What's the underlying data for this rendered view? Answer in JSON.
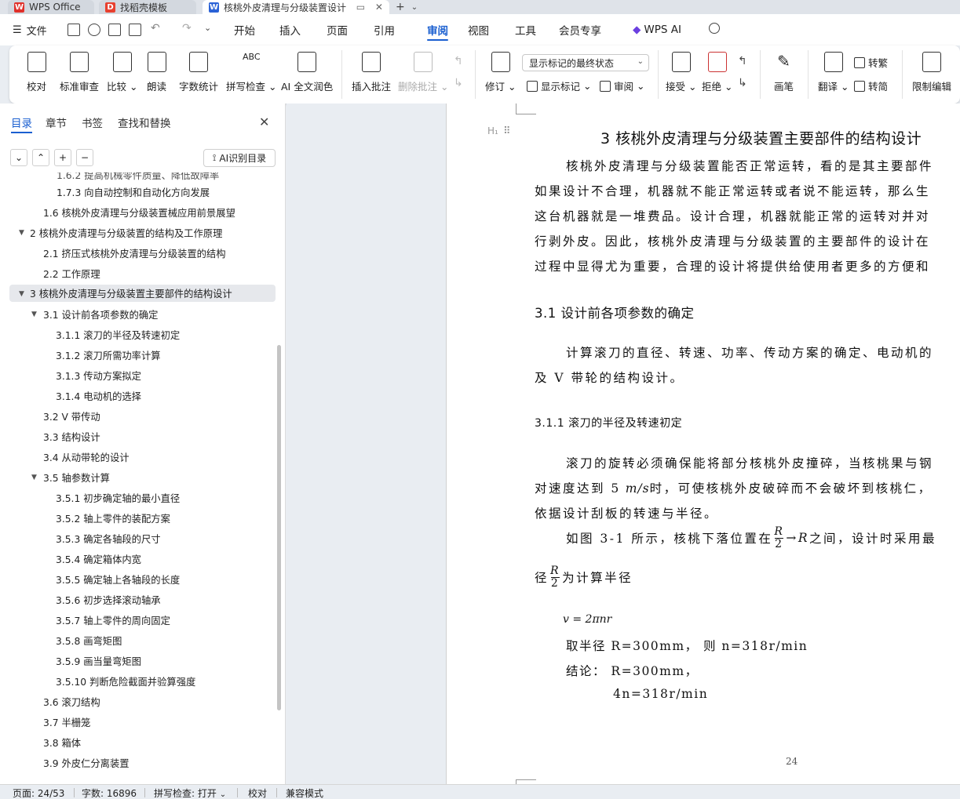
{
  "tabs": [
    {
      "label": "WPS Office",
      "icon": "wps-logo-icon"
    },
    {
      "label": "找稻壳模板",
      "icon": "docer-logo-icon"
    },
    {
      "label": "核桃外皮清理与分级装置设计",
      "icon": "word-doc-icon"
    }
  ],
  "menu": {
    "file": "文件",
    "items": [
      "开始",
      "插入",
      "页面",
      "引用",
      "审阅",
      "视图",
      "工具",
      "会员专享"
    ],
    "active": "审阅",
    "wps_ai": "WPS AI"
  },
  "ribbon": {
    "proofread": "校对",
    "standard_review": "标准审查",
    "compare": "比较",
    "read_aloud": "朗读",
    "word_count": "字数统计",
    "spell_check": "拼写检查",
    "ai_polish": "AI 全文润色",
    "insert_comment": "插入批注",
    "delete_comment": "删除批注",
    "markup_select": "显示标记的最终状态",
    "revise": "修订",
    "show_markup": "显示标记",
    "review": "审阅",
    "accept": "接受",
    "reject": "拒绝",
    "pen": "画笔",
    "translate": "翻译",
    "to_traditional": "转繁",
    "to_simplified": "转简",
    "restrict_edit": "限制编辑"
  },
  "panel": {
    "tabs": [
      "目录",
      "章节",
      "书签",
      "查找和替换"
    ],
    "active_tab": "目录",
    "ai_toc": "AI识别目录",
    "toc": [
      {
        "label": "1.6.2  提高机械零件质量、降低故障率",
        "level": 3
      },
      {
        "label": "1.7.3  向自动控制和自动化方向发展",
        "level": 3
      },
      {
        "label": "1.6  核桃外皮清理与分级装置械应用前景展望",
        "level": 2
      },
      {
        "label": "2   核桃外皮清理与分级装置的结构及工作原理",
        "level": 1,
        "expanded": true
      },
      {
        "label": "2.1  挤压式核桃外皮清理与分级装置的结构",
        "level": 2
      },
      {
        "label": "2.2  工作原理",
        "level": 2
      },
      {
        "label": "3   核桃外皮清理与分级装置主要部件的结构设计",
        "level": 1,
        "expanded": true,
        "selected": true
      },
      {
        "label": "3.1 设计前各项参数的确定",
        "level": 2,
        "expanded": true
      },
      {
        "label": "3.1.1  滚刀的半径及转速初定",
        "level": 3
      },
      {
        "label": "3.1.2  滚刀所需功率计算",
        "level": 3
      },
      {
        "label": "3.1.3  传动方案拟定",
        "level": 3
      },
      {
        "label": "3.1.4  电动机的选择",
        "level": 3
      },
      {
        "label": "3.2 V 带传动",
        "level": 2
      },
      {
        "label": "3.3  结构设计",
        "level": 2
      },
      {
        "label": "3.4  从动带轮的设计",
        "level": 2
      },
      {
        "label": "3.5  轴参数计算",
        "level": 2,
        "expanded": true
      },
      {
        "label": "3.5.1  初步确定轴的最小直径",
        "level": 3
      },
      {
        "label": "3.5.2  轴上零件的装配方案",
        "level": 3
      },
      {
        "label": "3.5.3  确定各轴段的尺寸",
        "level": 3
      },
      {
        "label": "3.5.4  确定箱体内宽",
        "level": 3
      },
      {
        "label": "3.5.5  确定轴上各轴段的长度",
        "level": 3
      },
      {
        "label": "3.5.6  初步选择滚动轴承",
        "level": 3
      },
      {
        "label": "3.5.7  轴上零件的周向固定",
        "level": 3
      },
      {
        "label": "3.5.8  画弯矩图",
        "level": 3
      },
      {
        "label": "3.5.9  画当量弯矩图",
        "level": 3
      },
      {
        "label": "3.5.10  判断危险截面并验算强度",
        "level": 3
      },
      {
        "label": "3.6  滚刀结构",
        "level": 2
      },
      {
        "label": "3.7  半栅笼",
        "level": 2
      },
      {
        "label": "3.8  箱体",
        "level": 2
      },
      {
        "label": "3.9  外皮仁分离装置",
        "level": 2
      }
    ]
  },
  "document": {
    "heading_marker": "H₁",
    "chapter_title": "3   核桃外皮清理与分级装置主要部件的结构设计",
    "para1": [
      "核桃外皮清理与分级装置能否正常运转，看的是其主要部件",
      "如果设计不合理，机器就不能正常运转或者说不能运转，那么生",
      "这台机器就是一堆费品。设计合理，机器就能正常的运转对并对",
      "行剥外皮。因此，核桃外皮清理与分级装置的主要部件的设计在",
      "过程中显得尤为重要，合理的设计将提供给使用者更多的方便和"
    ],
    "section_31": "3.1 设计前各项参数的确定",
    "para2": [
      "计算滚刀的直径、转速、功率、传动方案的确定、电动机的",
      "及 V 带轮的结构设计。"
    ],
    "section_311": "3.1.1  滚刀的半径及转速初定",
    "para3_1": "滚刀的旋转必须确保能将部分核桃外皮撞碎，当核桃果与钢",
    "para3_2a": "对速度达到 5",
    "para3_2_unit": " m/s",
    "para3_2b": "时，可使核桃外皮破碎而不会破坏到核桃仁，",
    "para3_3": "依据设计刮板的转速与半径。",
    "para4_a": "如图 3-1 所示，核桃下落位置在",
    "para4_frac_num": "R",
    "para4_frac_den": "2",
    "para4_arrow": "→R",
    "para4_b": "之间，设计时采用最",
    "para5_a": "径",
    "para5_frac_num": "R",
    "para5_frac_den": "2",
    "para5_b": "为计算半径",
    "formula": "v = 2πnr",
    "line_radius": "取半径 R=300mm， 则 n=318r/min",
    "line_conclusion": "结论：  R=300mm，",
    "line_n": "4n=318r/min",
    "page_number": "24"
  },
  "status": {
    "page": "页面: 24/53",
    "words": "字数: 16896",
    "spell": "拼写检查: 打开",
    "proof": "校对",
    "compat": "兼容模式"
  }
}
